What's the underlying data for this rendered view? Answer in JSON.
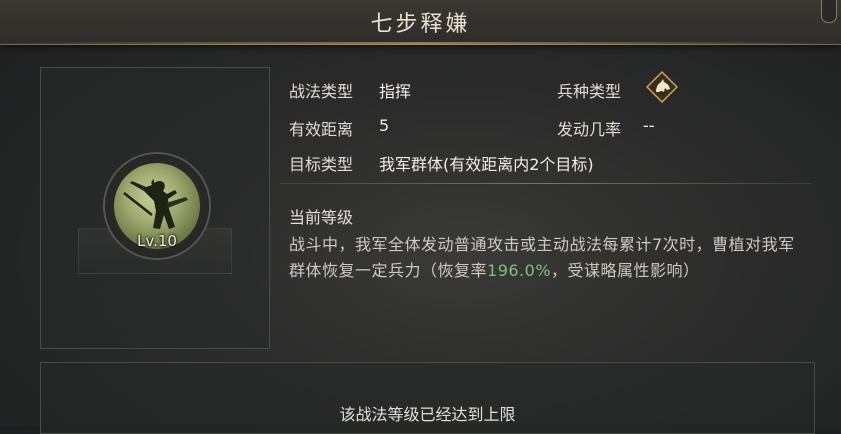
{
  "title": "七步释嫌",
  "skill": {
    "level_label": "Lv.10",
    "icon": "warrior-silhouette-icon"
  },
  "info": {
    "type_label": "战法类型",
    "type_value": "指挥",
    "troop_label": "兵种类型",
    "troop_icon": "horse-head-icon",
    "range_label": "有效距离",
    "range_value": "5",
    "chance_label": "发动几率",
    "chance_value": "--",
    "target_label": "目标类型",
    "target_value": "我军群体(有效距离内2个目标)"
  },
  "current_level": {
    "title": "当前等级",
    "desc_part1": "战斗中，我军全体发动普通攻击或主动战法每累计7次时，曹植对我军群体恢复一定兵力（恢复率",
    "desc_highlight": "196.0%",
    "desc_part2": "，受谋略属性影响）"
  },
  "footer": {
    "max_level_text": "该战法等级已经达到上限"
  },
  "colors": {
    "highlight": "#7fc07a",
    "gold_border": "#7a6a4a",
    "skill_disc": "#a3ad72"
  }
}
